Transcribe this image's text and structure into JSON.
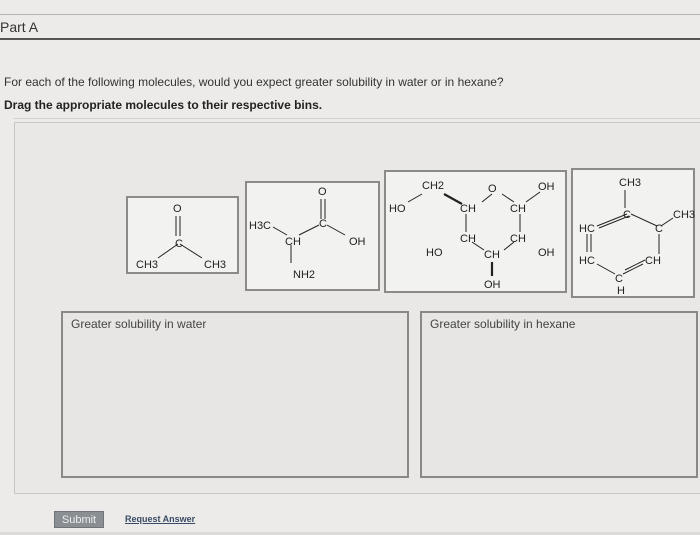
{
  "part": {
    "title": "Part A"
  },
  "question": "For each of the following molecules, would you expect greater solubility in water or in hexane?",
  "instruction": "Drag the appropriate molecules to their respective bins.",
  "molecules": {
    "acetone": {
      "atoms": [
        "O",
        "C",
        "CH3",
        "CH3"
      ]
    },
    "alanine": {
      "atoms": [
        "O",
        "H3C",
        "C",
        "CH",
        "OH",
        "NH2"
      ]
    },
    "glucose": {
      "atoms": [
        "CH2",
        "O",
        "OH",
        "HO",
        "CH",
        "CH",
        "CH",
        "CH",
        "HO",
        "CH",
        "OH",
        "OH"
      ]
    },
    "toluene": {
      "atoms": [
        "CH3",
        "C",
        "CH3",
        "HC",
        "C",
        "HC",
        "CH",
        "C",
        "H"
      ]
    }
  },
  "bins": {
    "water": {
      "label": "Greater solubility in water"
    },
    "hexane": {
      "label": "Greater solubility in hexane"
    }
  },
  "buttons": {
    "submit": "Submit",
    "request_answer": "Request Answer"
  }
}
